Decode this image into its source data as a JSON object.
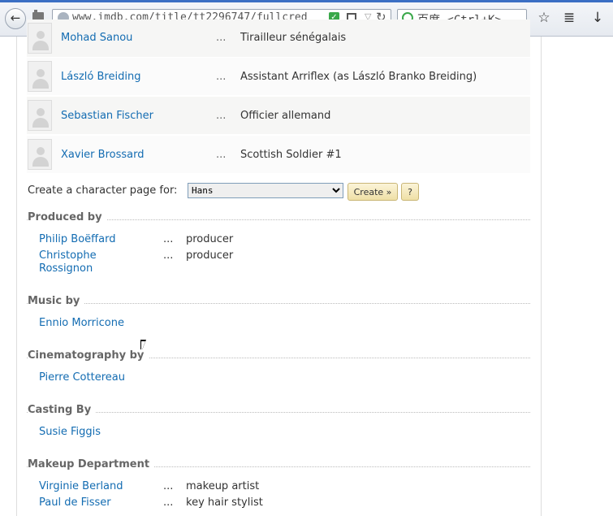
{
  "browser": {
    "url": "www.imdb.com/title/tt2296747/fullcredits",
    "search_placeholder": "百度 <Ctrl+K>"
  },
  "cast": [
    {
      "name": "Mohad Sanou",
      "dots": "...",
      "character": "Tirailleur sénégalais"
    },
    {
      "name": "László Breiding",
      "dots": "...",
      "character": "Assistant Arriflex (as László Branko Breiding)"
    },
    {
      "name": "Sebastian Fischer",
      "dots": "...",
      "character": "Officier allemand"
    },
    {
      "name": "Xavier Brossard",
      "dots": "...",
      "character": "Scottish Soldier #1"
    }
  ],
  "character_page": {
    "label": "Create a character page for:",
    "selected": "Hans",
    "create_label": "Create »",
    "help_label": "?"
  },
  "sections": {
    "produced": {
      "title": "Produced by",
      "rows": [
        {
          "name": "Philip Boëffard",
          "dots": "...",
          "role": "producer"
        },
        {
          "name": "Christophe Rossignon",
          "dots": "...",
          "role": "producer"
        }
      ]
    },
    "music": {
      "title": "Music by",
      "rows": [
        {
          "name": "Ennio Morricone"
        }
      ]
    },
    "cinematography": {
      "title": "Cinematography by",
      "rows": [
        {
          "name": "Pierre Cottereau"
        }
      ]
    },
    "casting": {
      "title": "Casting By",
      "rows": [
        {
          "name": "Susie Figgis"
        }
      ]
    },
    "makeup": {
      "title": "Makeup Department",
      "rows": [
        {
          "name": "Virginie Berland",
          "dots": "...",
          "role": "makeup artist"
        },
        {
          "name": "Paul de Fisser",
          "dots": "...",
          "role": "key hair stylist"
        }
      ]
    }
  }
}
